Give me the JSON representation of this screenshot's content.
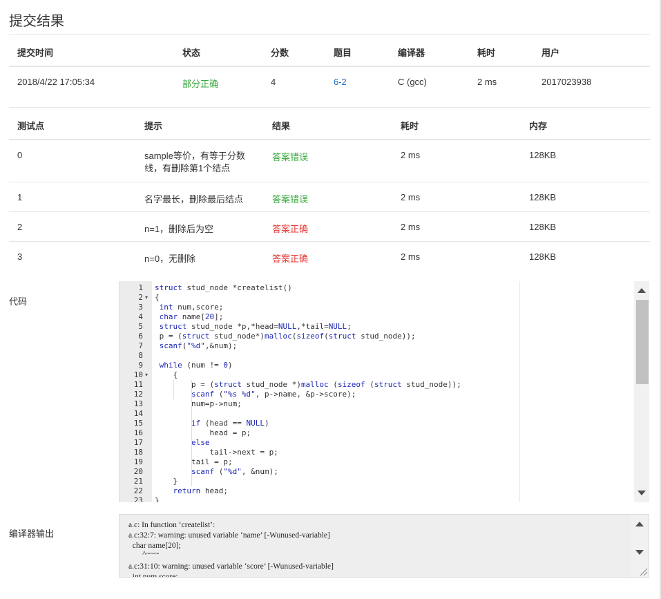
{
  "page": {
    "title": "提交结果"
  },
  "submission": {
    "headers": [
      "提交时间",
      "状态",
      "分数",
      "题目",
      "编译器",
      "耗时",
      "用户"
    ],
    "row": {
      "time": "2018/4/22 17:05:34",
      "status": "部分正确",
      "score": "4",
      "problem": "6-2",
      "compiler": "C (gcc)",
      "elapsed": "2 ms",
      "user": "2017023938"
    }
  },
  "tests": {
    "headers": [
      "测试点",
      "提示",
      "结果",
      "耗时",
      "内存"
    ],
    "rows": [
      {
        "id": "0",
        "hint": "sample等价，有等于分数线，有删除第1个结点",
        "result": "答案错误",
        "result_color": "#38a93c",
        "time": "2 ms",
        "mem": "128KB"
      },
      {
        "id": "1",
        "hint": "名字最长，删除最后结点",
        "result": "答案错误",
        "result_color": "#38a93c",
        "time": "2 ms",
        "mem": "128KB"
      },
      {
        "id": "2",
        "hint": "n=1，删除后为空",
        "result": "答案正确",
        "result_color": "#e53935",
        "time": "2 ms",
        "mem": "128KB"
      },
      {
        "id": "3",
        "hint": "n=0，无删除",
        "result": "答案正确",
        "result_color": "#e53935",
        "time": "2 ms",
        "mem": "128KB"
      }
    ]
  },
  "code_section": {
    "label": "代码",
    "line_numbers": [
      "1",
      "2",
      "3",
      "4",
      "5",
      "6",
      "7",
      "8",
      "9",
      "10",
      "11",
      "12",
      "13",
      "14",
      "15",
      "16",
      "17",
      "18",
      "19",
      "20",
      "21",
      "22",
      "23"
    ],
    "fold_lines": [
      "2",
      "10"
    ],
    "lines": [
      "struct stud_node *createlist()",
      "{",
      " int num,score;",
      " char name[20];",
      " struct stud_node *p,*head=NULL,*tail=NULL;",
      " p = (struct stud_node*)malloc(sizeof(struct stud_node));",
      " scanf(\"%d\",&num);",
      "",
      " while (num != 0)",
      "    {",
      "        p = (struct stud_node *)malloc (sizeof (struct stud_node));",
      "        scanf (\"%s %d\", p->name, &p->score);",
      "        num=p->num;",
      "",
      "        if (head == NULL)",
      "            head = p;",
      "        else",
      "            tail->next = p;",
      "        tail = p;",
      "        scanf (\"%d\", &num);",
      "    }",
      "    return head;",
      "}"
    ]
  },
  "compiler_output": {
    "label": "编译器输出",
    "lines": [
      "a.c: In function ‘createlist’:",
      "a.c:32:7: warning: unused variable ‘name’ [-Wunused-variable]",
      "  char name[20];",
      "       ^~~~",
      "a.c:31:10: warning: unused variable ‘score’ [-Wunused-variable]",
      "  int num,score;"
    ]
  },
  "icons": [
    "fold-arrow-icon",
    "scroll-up-arrow-icon",
    "scroll-down-arrow-icon",
    "resize-grip-icon"
  ]
}
